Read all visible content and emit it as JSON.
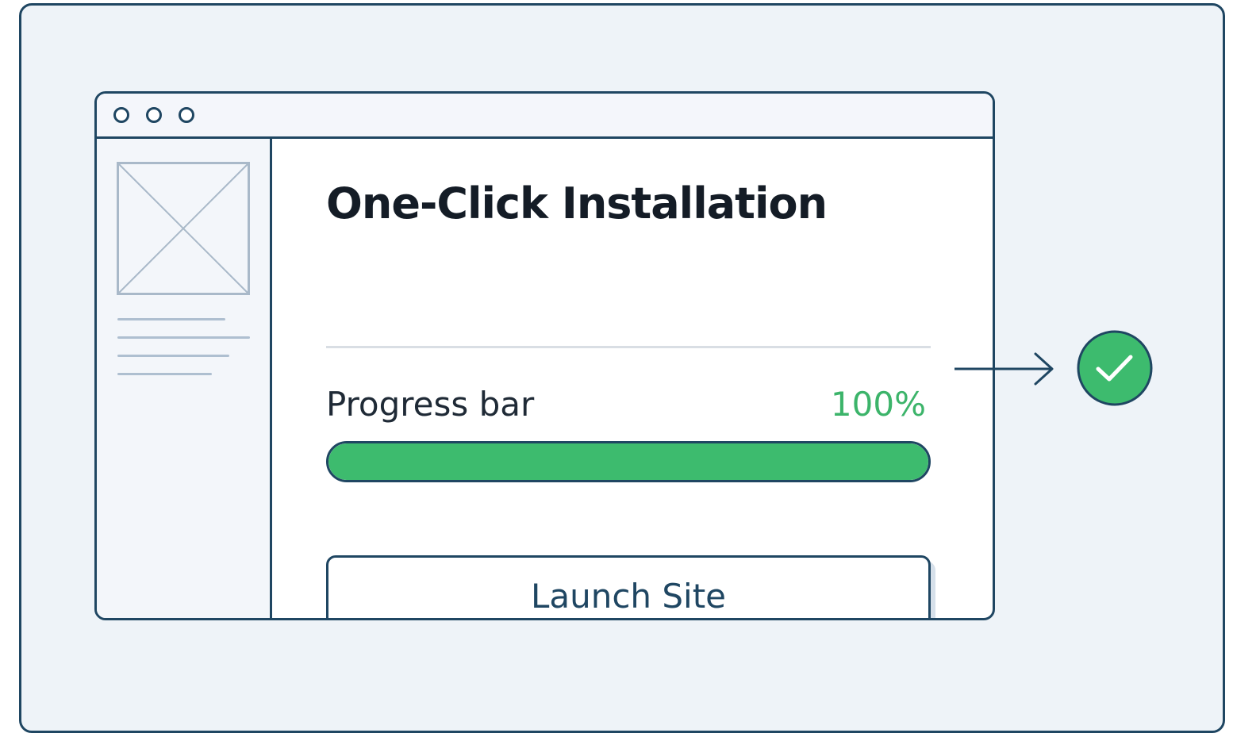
{
  "installer": {
    "title": "One-Click Installation",
    "progress": {
      "label": "Progress bar",
      "percent_text": "100%",
      "value": 1.0
    },
    "launch_button_label": "Launch Site"
  },
  "icons": {
    "window_controls": [
      "window-dot-icon",
      "window-dot-icon",
      "window-dot-icon"
    ],
    "image_placeholder": "image-placeholder-icon",
    "arrow": "arrow-right-icon",
    "success": "check-circle-icon"
  },
  "colors": {
    "outline": "#1f4662",
    "accent_green": "#3dbb6e",
    "percent_green": "#3cb46a",
    "title_text": "#141c26"
  }
}
